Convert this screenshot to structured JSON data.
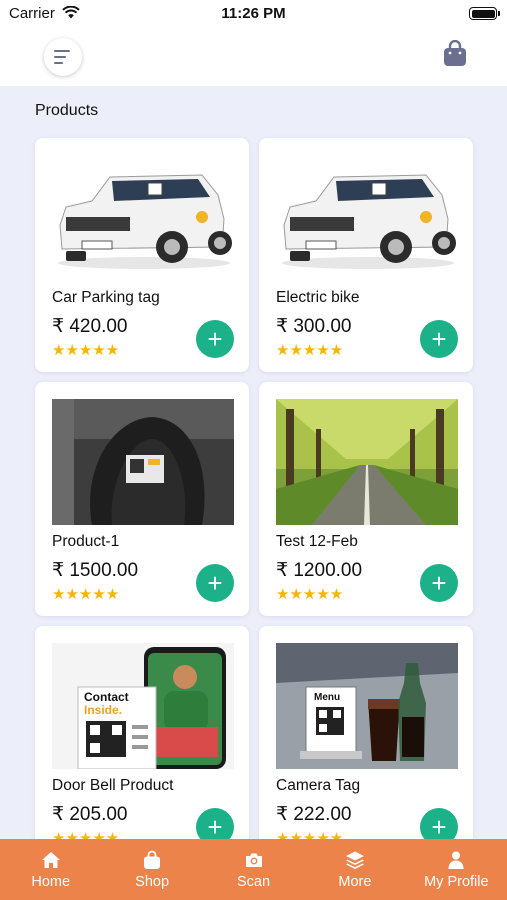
{
  "status_bar": {
    "carrier": "Carrier",
    "time": "11:26 PM"
  },
  "header": {
    "menu_icon": "menu-icon",
    "cart_icon": "shopping-bag-icon"
  },
  "section_title": "Products",
  "products": [
    {
      "name": "Car Parking tag",
      "price": "₹ 420.00",
      "rating": 5,
      "stars": "★★★★★",
      "image": "white-suv-with-qr-tag"
    },
    {
      "name": "Electric bike",
      "price": "₹ 300.00",
      "rating": 5,
      "stars": "★★★★★",
      "image": "white-suv-with-qr-tag"
    },
    {
      "name": "Product-1",
      "price": "₹ 1500.00",
      "rating": 5,
      "stars": "★★★★★",
      "image": "scooter-with-qr-sticker"
    },
    {
      "name": "Test 12-Feb",
      "price": "₹ 1200.00",
      "rating": 5,
      "stars": "★★★★★",
      "image": "tree-lined-road"
    },
    {
      "name": "Door Bell Product",
      "price": "₹ 205.00",
      "rating": 5,
      "stars": "★★★★★",
      "image": "contact-inside-qr-poster",
      "image_text": [
        "Contact",
        "Inside."
      ]
    },
    {
      "name": "Camera Tag",
      "price": "₹ 222.00",
      "rating": 5,
      "stars": "★★★★★",
      "image": "menu-qr-stand-with-drinks",
      "image_text": [
        "Menu"
      ]
    }
  ],
  "tabs": [
    {
      "label": "Home",
      "icon": "home-icon"
    },
    {
      "label": "Shop",
      "icon": "shop-bag-icon"
    },
    {
      "label": "Scan",
      "icon": "camera-icon"
    },
    {
      "label": "More",
      "icon": "layers-icon"
    },
    {
      "label": "My Profile",
      "icon": "user-icon"
    }
  ],
  "colors": {
    "accent": "#1cb188",
    "tab_bar": "#ec834a",
    "stars": "#f7b500",
    "background": "#eceefa"
  }
}
